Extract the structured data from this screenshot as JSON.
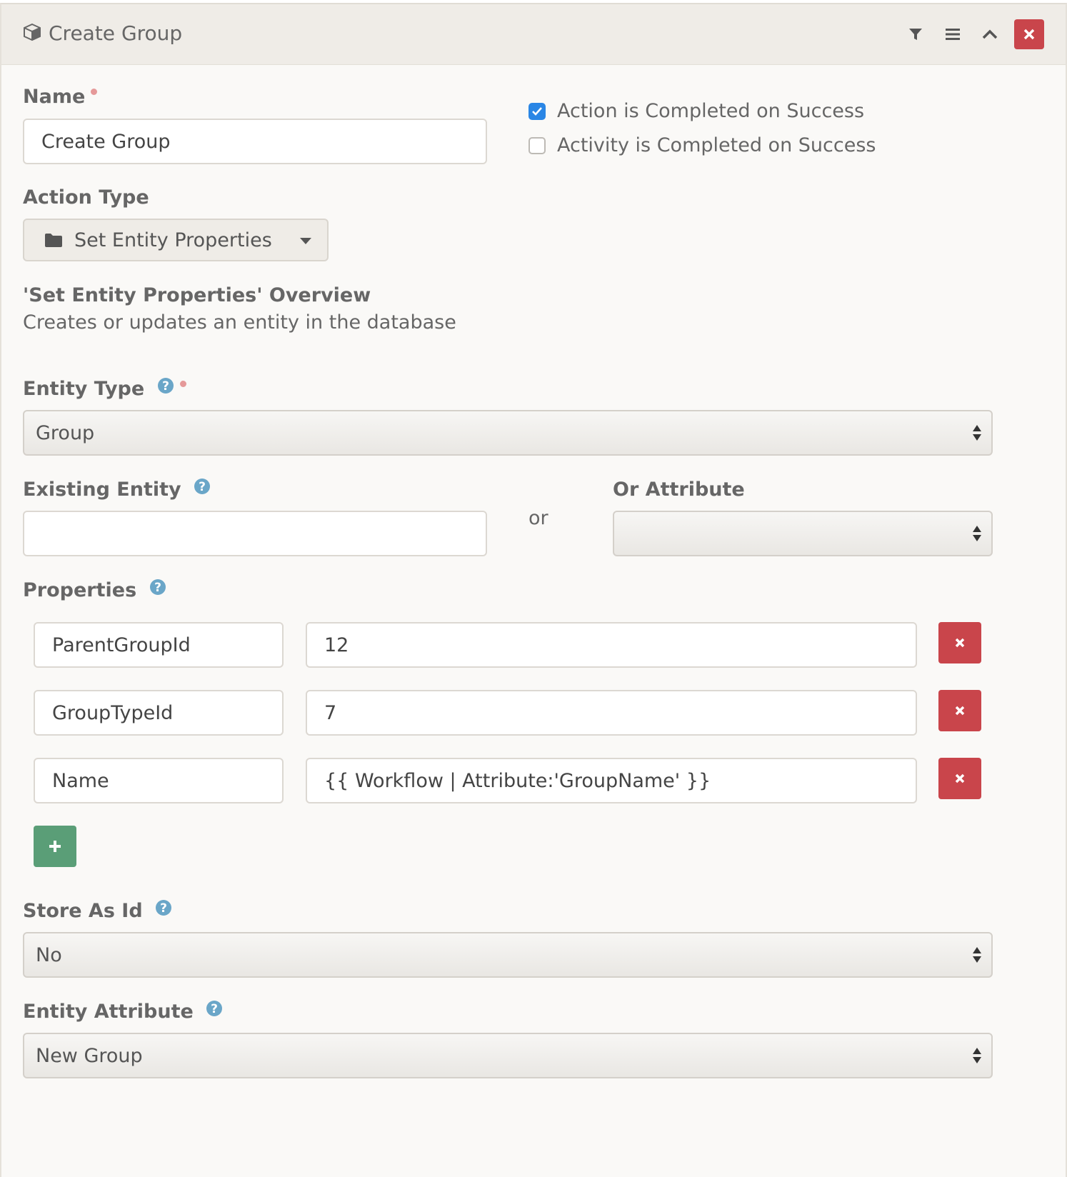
{
  "header": {
    "title": "Create Group",
    "icons": [
      "cube-icon",
      "filter-icon",
      "menu-icon",
      "chevron-up-icon",
      "close-icon"
    ]
  },
  "name_field": {
    "label": "Name",
    "value": "Create Group",
    "required": true
  },
  "checkboxes": [
    {
      "label": "Action is Completed on Success",
      "checked": true
    },
    {
      "label": "Activity is Completed on Success",
      "checked": false
    }
  ],
  "action_type": {
    "label": "Action Type",
    "value": "Set Entity Properties"
  },
  "overview": {
    "title": "'Set Entity Properties' Overview",
    "description": "Creates or updates an entity in the database"
  },
  "entity_type": {
    "label": "Entity Type",
    "value": "Group",
    "required": true
  },
  "existing_entity": {
    "label": "Existing Entity",
    "value": ""
  },
  "or_text": "or",
  "or_attribute": {
    "label": "Or Attribute",
    "value": ""
  },
  "properties": {
    "label": "Properties",
    "rows": [
      {
        "key": "ParentGroupId",
        "value": "12"
      },
      {
        "key": "GroupTypeId",
        "value": "7"
      },
      {
        "key": "Name",
        "value": "{{ Workflow | Attribute:'GroupName' }}"
      }
    ]
  },
  "store_as_id": {
    "label": "Store As Id",
    "value": "No"
  },
  "entity_attribute": {
    "label": "Entity Attribute",
    "value": "New Group"
  },
  "colors": {
    "danger": "#c9454b",
    "success": "#5a9e77",
    "checkbox": "#2a86e5",
    "help": "#6aa6c8",
    "required": "#e59999"
  }
}
